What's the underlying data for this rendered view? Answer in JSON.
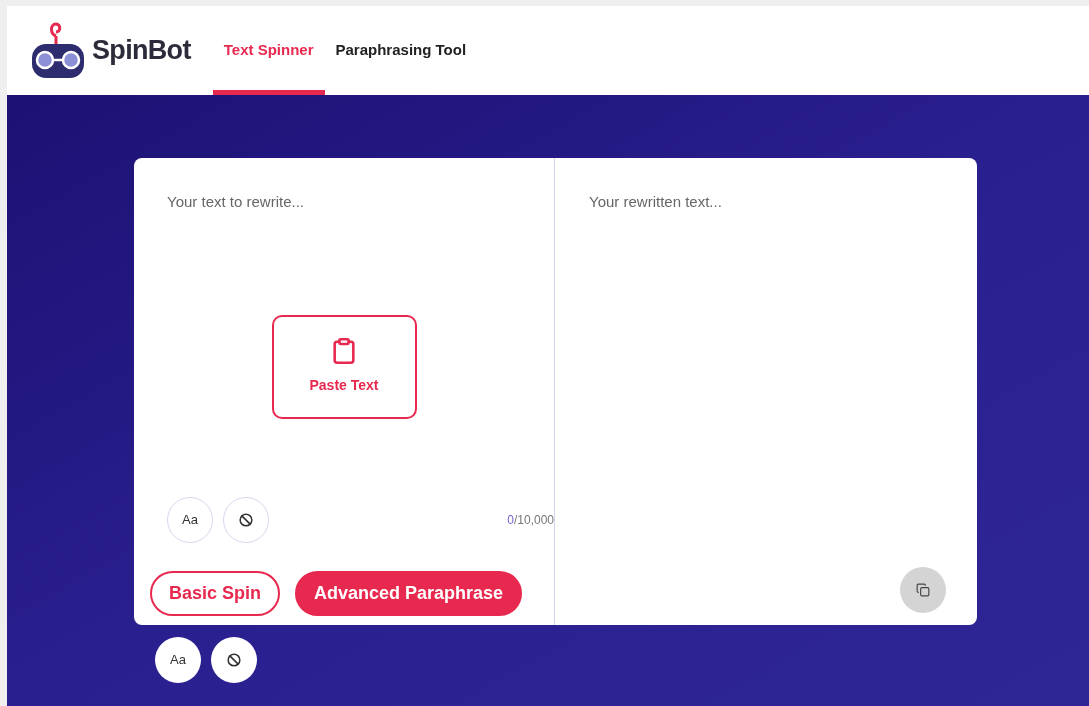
{
  "header": {
    "brand": "SpinBot",
    "tabs": [
      {
        "label": "Text Spinner",
        "selected": true
      },
      {
        "label": "Paraphrasing Tool",
        "selected": false
      }
    ]
  },
  "input_panel": {
    "placeholder": "Your text to rewrite...",
    "paste_button": "Paste Text",
    "tools": [
      {
        "kind": "case",
        "label": "Aa"
      },
      {
        "kind": "clear"
      }
    ],
    "counter": {
      "count": "0",
      "limit": "/10,000"
    }
  },
  "output_panel": {
    "placeholder": "Your rewritten text..."
  },
  "modes": [
    {
      "label": "Basic Spin",
      "selected": false
    },
    {
      "label": "Advanced Paraphrase",
      "selected": true
    }
  ],
  "bottom_tools": [
    {
      "kind": "case",
      "label": "Aa"
    },
    {
      "kind": "clear"
    }
  ]
}
